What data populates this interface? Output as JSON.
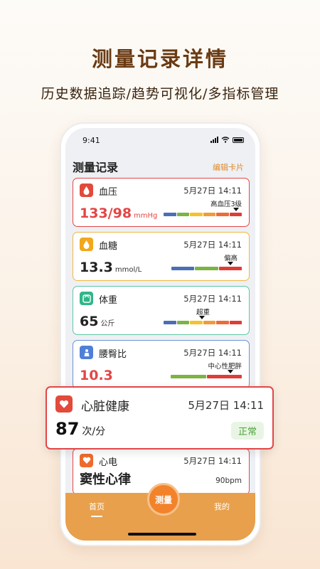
{
  "headline": "测量记录详情",
  "subline": "历史数据追踪/趋势可视化/多指标管理",
  "status": {
    "time": "9:41"
  },
  "page": {
    "title": "测量记录",
    "edit": "编辑卡片"
  },
  "cards": [
    {
      "name": "血压",
      "date": "5月27日  14:11",
      "value": "133/98",
      "unit": "mmHg",
      "level": "高血压3级",
      "color": "#e34646",
      "border": "#e34646"
    },
    {
      "name": "血糖",
      "date": "5月27日  14:11",
      "value": "13.3",
      "unit": "mmol/L",
      "level": "偏高",
      "color": "#222222",
      "border": "#f1b640"
    },
    {
      "name": "体重",
      "date": "5月27日  14:11",
      "value": "65",
      "unit": "公斤",
      "level": "超重",
      "color": "#222222",
      "border": "#5cc7a6"
    },
    {
      "name": "腰臀比",
      "date": "5月27日  14:11",
      "value": "10.3",
      "unit": "",
      "level": "中心性肥胖",
      "color": "#e34646",
      "border": "#6b93d6"
    },
    {
      "name": "心电",
      "date": "5月27日  14:11",
      "value": "窦性心律",
      "unit": "90bpm",
      "level": "",
      "color": "#222222",
      "border": "#e34646"
    }
  ],
  "heart": {
    "name": "心脏健康",
    "date": "5月27日  14:11",
    "value": "87",
    "unit": "次/分",
    "badge": "正常"
  },
  "tabs": {
    "home": "首页",
    "measure": "测量",
    "mine": "我的"
  },
  "colors": {
    "accent": "#e8a04c",
    "danger": "#e34646",
    "ok": "#4da23c"
  }
}
